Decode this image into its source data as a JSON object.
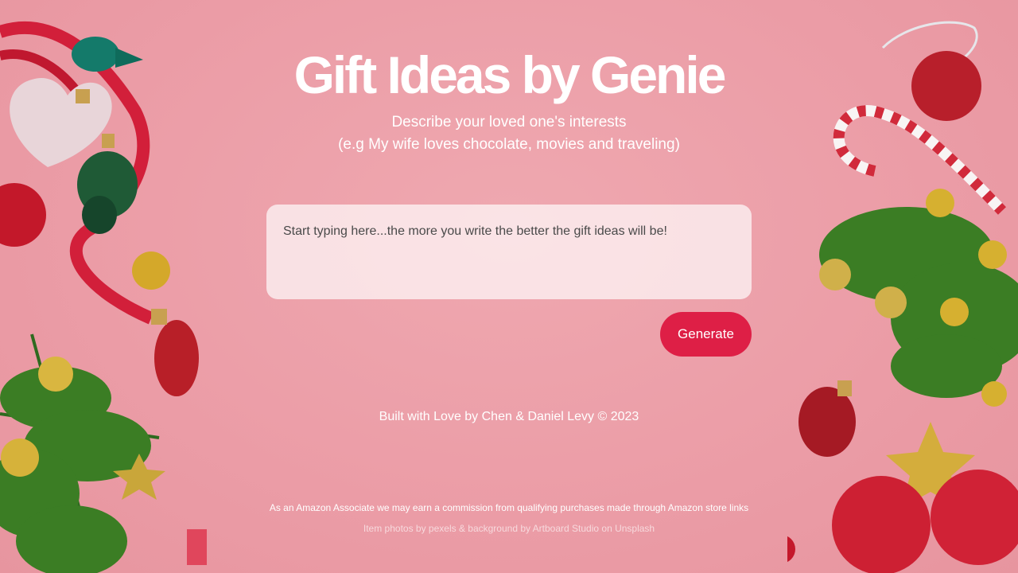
{
  "header": {
    "title": "Gift Ideas by Genie",
    "subtitle_line1": "Describe your loved one's interests",
    "subtitle_line2": "(e.g My wife loves chocolate, movies and traveling)"
  },
  "form": {
    "interests_placeholder": "Start typing here...the more you write the better the gift ideas will be!",
    "interests_value": "",
    "generate_label": "Generate"
  },
  "footer": {
    "built_by": "Built with Love by Chen & Daniel Levy © 2023",
    "disclaimer": "As an Amazon Associate we may earn a commission from qualifying purchases made through Amazon store links",
    "credits": "Item photos by pexels & background by Artboard Studio on Unsplash"
  },
  "colors": {
    "background": "#eda2aa",
    "accent": "#de1f46"
  },
  "decorations": [
    "christmas-ornament-icon",
    "pine-branch-icon",
    "candy-cane-icon",
    "gold-star-icon",
    "ribbon-icon"
  ]
}
